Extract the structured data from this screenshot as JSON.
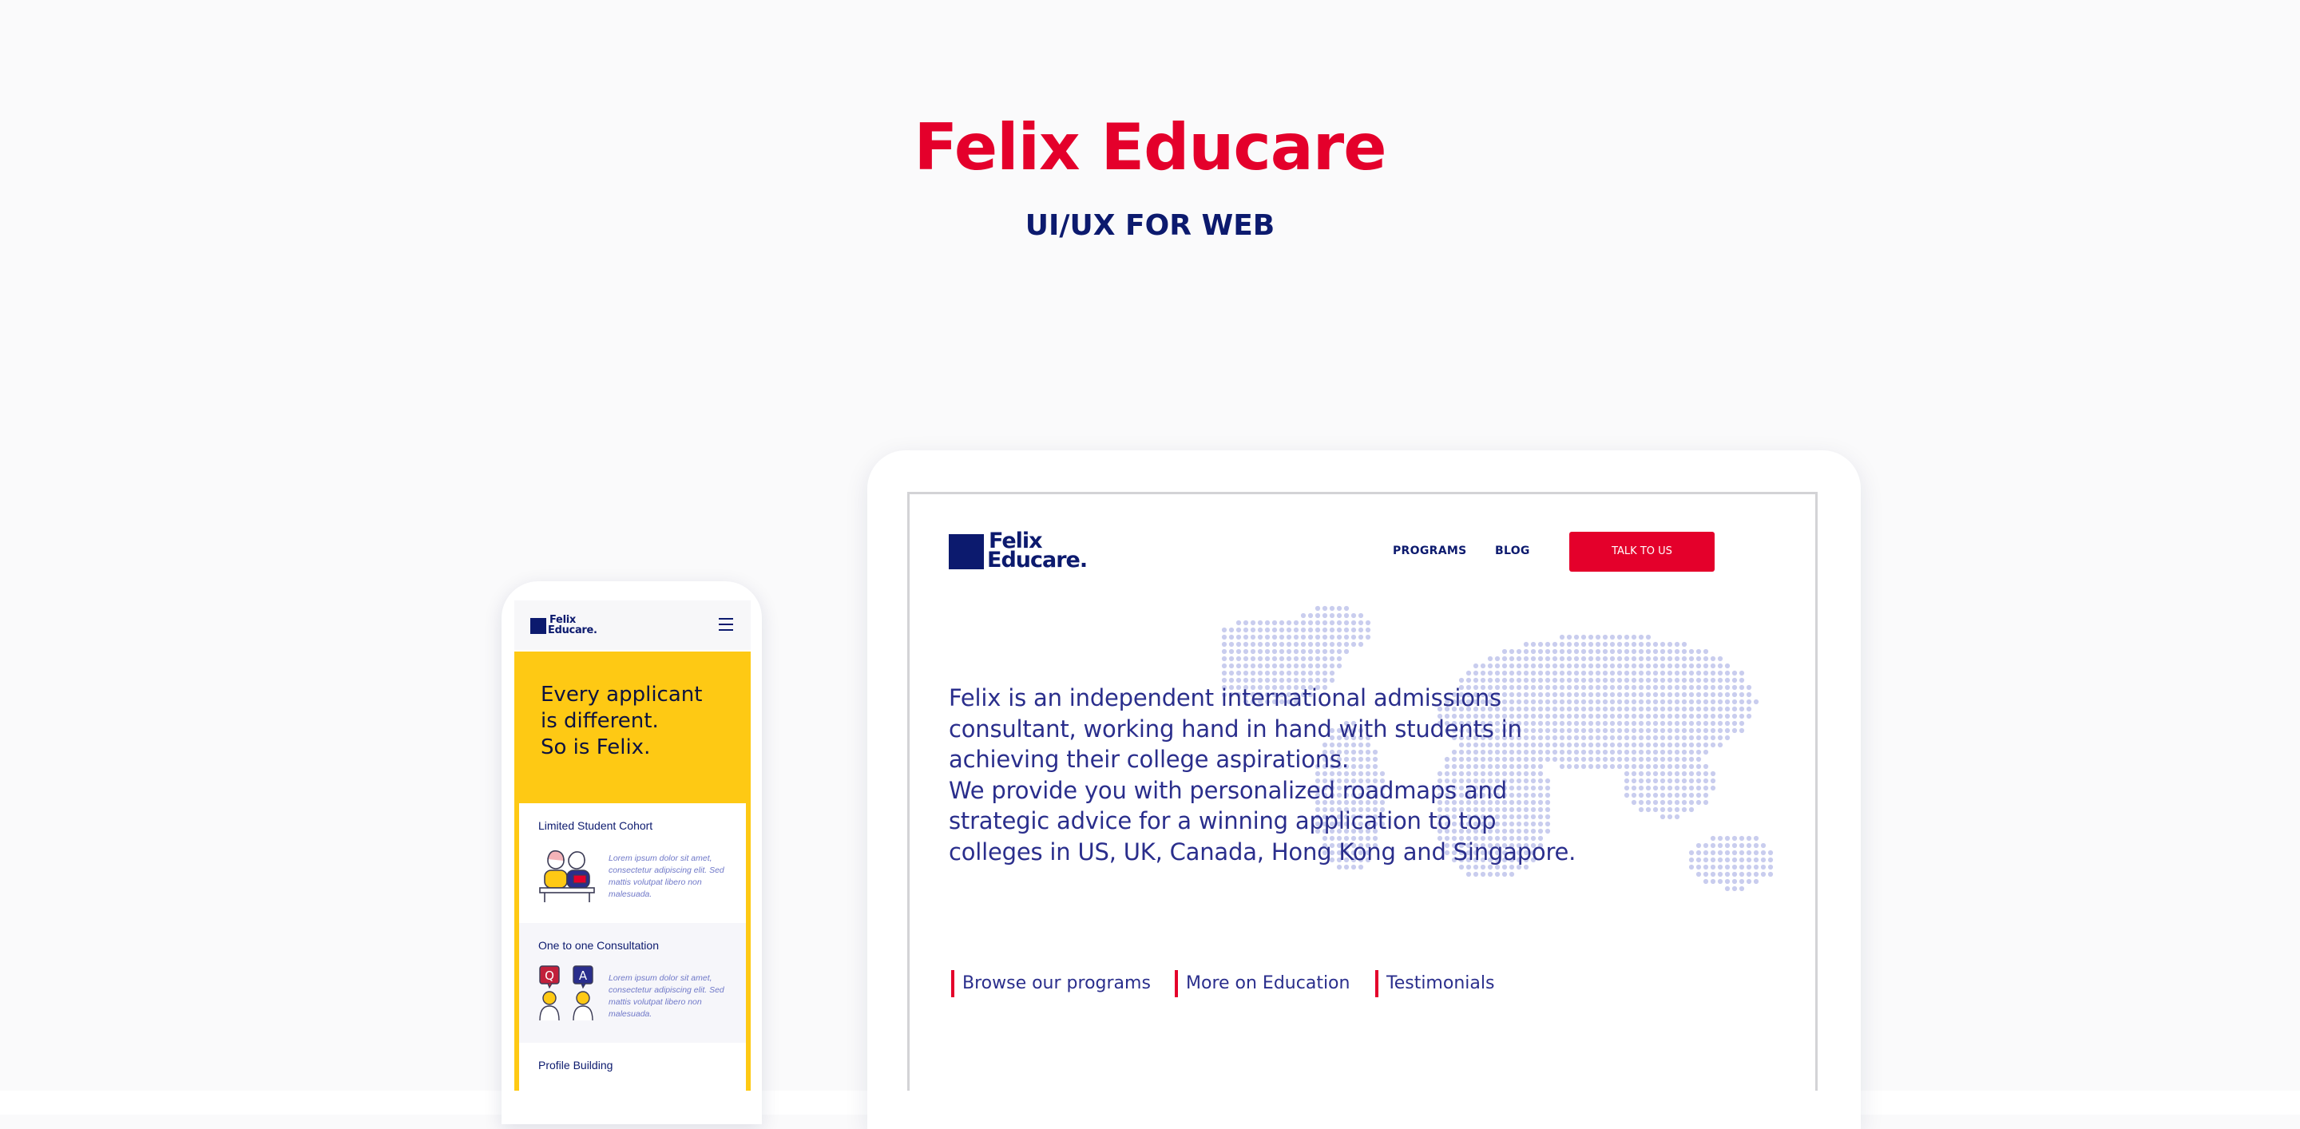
{
  "hero": {
    "title": "Felix Educare",
    "subtitle": "UI/UX FOR WEB"
  },
  "mobile": {
    "logo_line1": "Felix",
    "logo_line2": "Educare.",
    "menu_icon": "hamburger-menu-icon",
    "hero_lines": [
      "Every applicant",
      "is different.",
      "So is Felix."
    ],
    "hero_bg": "#fec914",
    "cards": [
      {
        "title": "Limited Student Cohort",
        "illustration": "two-students-icon",
        "description": "Lorem ipsum dolor sit amet, consectetur adipiscing elit. Sed mattis volutpat libero non malesuada."
      },
      {
        "title": "One to one Consultation",
        "illustration": "question-answer-icon",
        "description": "Lorem ipsum dolor sit amet, consectetur adipiscing elit. Sed mattis volutpat libero non malesuada."
      },
      {
        "title": "Profile Building"
      }
    ]
  },
  "desktop": {
    "logo_line1": "Felix",
    "logo_line2": "Educare.",
    "nav": [
      "PROGRAMS",
      "BLOG"
    ],
    "cta": "TALK TO US",
    "background_graphic": "dotted-world-map-icon",
    "intro_lines": [
      "Felix is an independent international admissions",
      "consultant, working hand in hand with students in",
      "achieving their college aspirations.",
      "We provide you with personalized roadmaps and",
      "strategic advice for a winning application to top",
      "colleges in US, UK, Canada, Hong Kong and Singapore."
    ],
    "links": [
      "Browse our programs",
      "More on Education",
      "Testimonials"
    ]
  },
  "colors": {
    "brand_red": "#e4002b",
    "brand_navy": "#0c1a6e",
    "accent_yellow": "#fec914",
    "map_dots": "#c9cdee"
  }
}
